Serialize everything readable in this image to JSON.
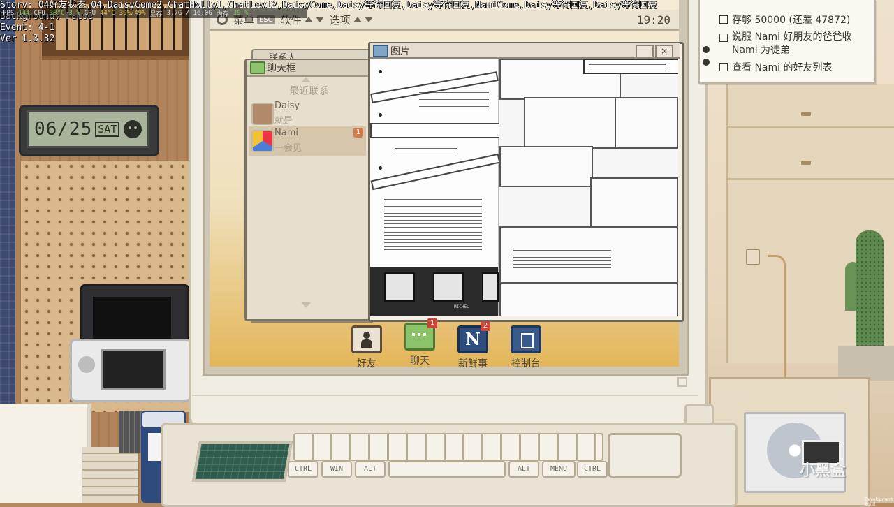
{
  "debug": {
    "story": "Story: 04好友状态,04.DaisyCome2,ChatHolly1,ChatLevi2,DaisyCome,Daisy等待回复,Daisy等待回复,NamiCome,Daisy等待回复,Daisy等待回复",
    "background": "Background: False",
    "event": "Event: 4-1",
    "version": "Ver 1.3.32",
    "perf": {
      "fps_label": "FPS",
      "fps": "144",
      "cpu_label": "CPU",
      "cpu_temp": "38°C",
      "cpu_load": "3 %",
      "gpu_label": "GPU",
      "gpu_temp": "44°C",
      "gpu_load": "39%/49%",
      "vram_label": "显存",
      "vram": "3.7G / 16.0G",
      "ram_label": "内存",
      "ram": "39 %"
    }
  },
  "clock": {
    "date": "06/25",
    "day": "SAT"
  },
  "menubar": {
    "menu_label": "菜单",
    "menu_key": "ESC",
    "software_label": "软件",
    "options_label": "选项",
    "time": "19:20"
  },
  "contacts_window": {
    "title": "联系人"
  },
  "chat_window": {
    "title": "聊天框",
    "section": "最近联系",
    "contacts": [
      {
        "name": "Daisy",
        "message": "就是",
        "badge": ""
      },
      {
        "name": "Nami",
        "message": "一会见",
        "badge": "1"
      }
    ]
  },
  "picture_window": {
    "title": "图片",
    "close": "×"
  },
  "comic_caption": "MICHEL",
  "dock": [
    {
      "label": "好友",
      "icon": "friends-icon",
      "badge": ""
    },
    {
      "label": "聊天",
      "icon": "chat-icon",
      "badge": "1"
    },
    {
      "label": "新鲜事",
      "icon": "news-icon",
      "badge": "2"
    },
    {
      "label": "控制台",
      "icon": "console-icon",
      "badge": ""
    }
  ],
  "keyboard": {
    "keys": [
      "CTRL",
      "WIN",
      "ALT",
      "ALT",
      "MENU",
      "CTRL"
    ]
  },
  "quests": [
    {
      "text": "存够 50000 (还差 47872)"
    },
    {
      "text": "说服 Nami 好朋友的爸爸收\nNami 为徒弟"
    },
    {
      "text": "查看 Nami 的好友列表"
    }
  ],
  "watermark": "小黑盒",
  "dev_build": "Development Build",
  "colors": {
    "screen_accent": "#e7b854",
    "badge_red": "#c8463a",
    "chat_green": "#8bc36b"
  }
}
